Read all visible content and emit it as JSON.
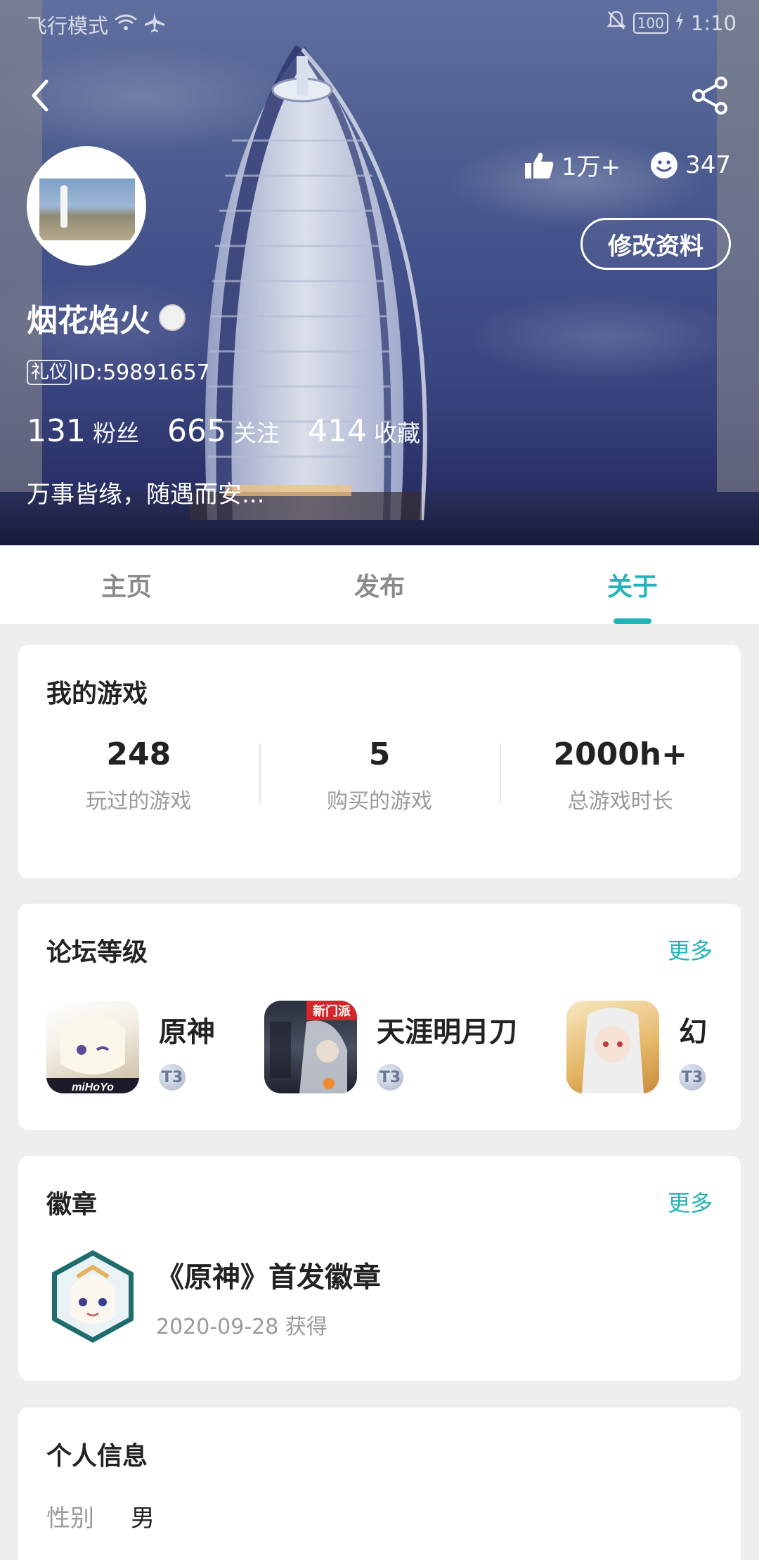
{
  "status_bar": {
    "carrier": "飞行模式",
    "battery": "100",
    "time": "1:10"
  },
  "header": {
    "likes": "1万+",
    "smiles": "347",
    "edit_label": "修改资料",
    "username": "烟花焰火",
    "tag": "礼仪",
    "id_text": "ID:59891657",
    "fans_num": "131",
    "fans_label": "粉丝",
    "follow_num": "665",
    "follow_label": "关注",
    "fav_num": "414",
    "fav_label": "收藏",
    "bio": "万事皆缘，随遇而安..."
  },
  "tabs": [
    {
      "label": "主页"
    },
    {
      "label": "发布"
    },
    {
      "label": "关于",
      "active": true
    }
  ],
  "my_games": {
    "title": "我的游戏",
    "stats": [
      {
        "value": "248",
        "label": "玩过的游戏"
      },
      {
        "value": "5",
        "label": "购买的游戏"
      },
      {
        "value": "2000h+",
        "label": "总游戏时长"
      }
    ]
  },
  "forum_level": {
    "title": "论坛等级",
    "more": "更多",
    "items": [
      {
        "name": "原神",
        "icon": "genshin-icon",
        "badge_text": "T3"
      },
      {
        "name": "天涯明月刀",
        "icon": "tianya-icon",
        "badge_text": "T3",
        "icon_tag": "新门派"
      },
      {
        "name": "幻",
        "icon": "game-icon",
        "badge_text": "T3"
      }
    ]
  },
  "badges": {
    "title": "徽章",
    "more": "更多",
    "item_title": "《原神》首发徽章",
    "item_date": "2020-09-28 获得"
  },
  "personal_info": {
    "title": "个人信息",
    "gender_key": "性别",
    "gender_value": "男"
  },
  "colors": {
    "accent": "#22b3b8",
    "card_bg": "#ffffff",
    "page_bg": "#eeeeee"
  }
}
